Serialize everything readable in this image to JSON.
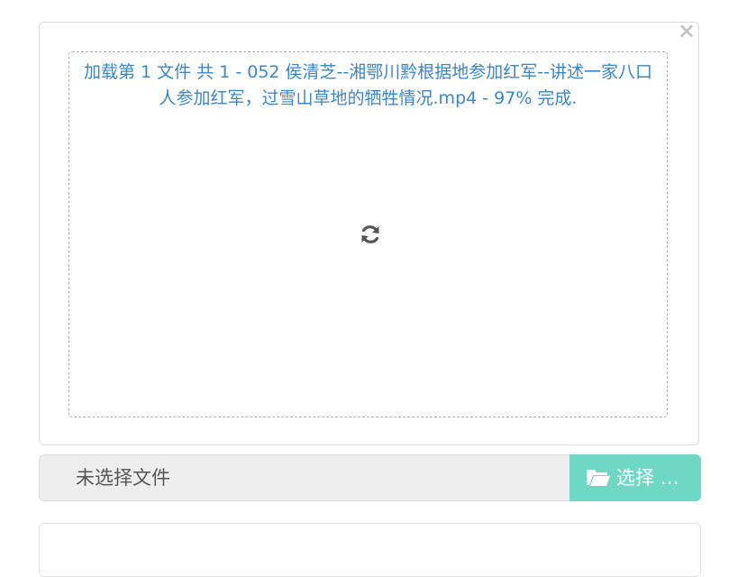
{
  "upload": {
    "close_label": "×",
    "status_text": "加载第 1 文件 共 1 - 052 侯清芝--湘鄂川黔根据地参加红军--讲述一家八口人参加红军，过雪山草地的牺牲情况.mp4 - 97% 完成.",
    "progress_percent": 97,
    "spinner_icon": "refresh-icon",
    "status_color": "#3a87c8"
  },
  "file_input": {
    "caption": "未选择文件",
    "browse_label": "选择 …",
    "browse_icon": "folder-open-icon",
    "browse_color": "#6fd8c4"
  }
}
